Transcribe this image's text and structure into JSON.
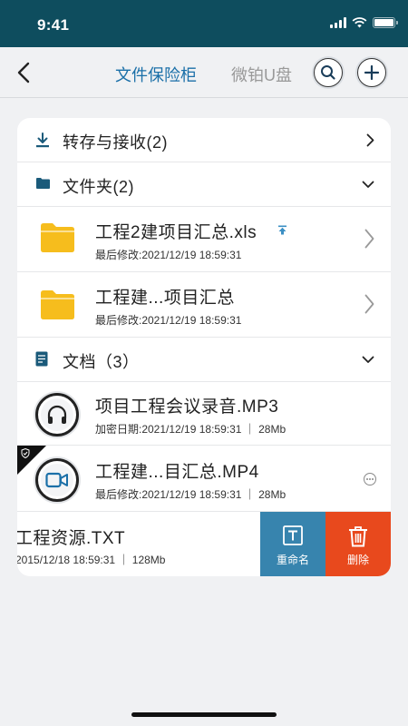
{
  "status_bar": {
    "time": "9:41"
  },
  "nav": {
    "tab_active": "文件保险柜",
    "tab_inactive": "微铂U盘"
  },
  "sections": {
    "transfer": {
      "label": "转存与接收(2)"
    },
    "folders": {
      "label": "文件夹(2)"
    },
    "documents": {
      "label": "文档（3）"
    }
  },
  "folders": [
    {
      "title": "工程2建项目汇总.xls",
      "meta": "最后修改:2021/12/19 18:59:31"
    },
    {
      "title": "工程建...项目汇总",
      "meta": "最后修改:2021/12/19 18:59:31"
    }
  ],
  "documents": [
    {
      "title": "项目工程会议录音.MP3",
      "meta": "加密日期:2021/12/19 18:59:31 ｜ 28Mb",
      "icon": "headphones-icon"
    },
    {
      "title": "工程建...目汇总.MP4",
      "meta": "最后修改:2021/12/19 18:59:31 ｜ 28Mb",
      "icon": "video-camera-icon"
    },
    {
      "title": "工程资源.TXT",
      "meta": "2015/12/18 18:59:31 ｜ 128Mb"
    }
  ],
  "actions": {
    "rename": "重命名",
    "delete": "删除"
  },
  "colors": {
    "header": "#0e4d5e",
    "accent": "#1a6fa8",
    "folder": "#f6bd1d",
    "rename": "#3784ae",
    "delete": "#e8491d"
  }
}
